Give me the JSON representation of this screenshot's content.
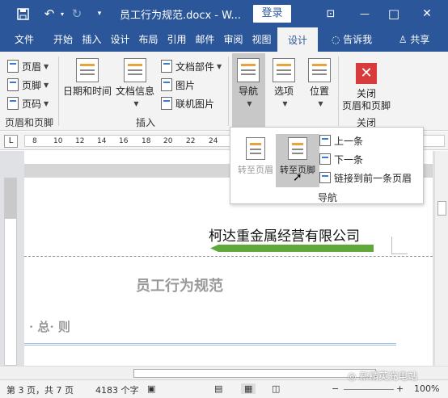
{
  "window": {
    "title": "员工行为规范.docx - W...",
    "login_label": "登录",
    "accent": "#2b579a"
  },
  "quick_access": {
    "save_icon": "save-icon",
    "undo_icon": "undo-icon",
    "redo_icon": "redo-icon",
    "customize_icon": "customize-icon"
  },
  "window_controls": {
    "ribbon_display": "⊡",
    "minimize": "—",
    "maximize": "□",
    "close": "✕"
  },
  "tabs": [
    {
      "label": "文件"
    },
    {
      "label": "开始"
    },
    {
      "label": "插入"
    },
    {
      "label": "设计"
    },
    {
      "label": "布局"
    },
    {
      "label": "引用"
    },
    {
      "label": "邮件"
    },
    {
      "label": "审阅"
    },
    {
      "label": "视图"
    },
    {
      "label": "设计",
      "active": true
    },
    {
      "label": "告诉我"
    },
    {
      "label": "共享"
    }
  ],
  "ribbon": {
    "header_footer_group": {
      "items": [
        "页眉",
        "页脚",
        "页码"
      ],
      "label": "页眉和页脚"
    },
    "insert_group": {
      "date_time": "日期和时间",
      "doc_info": "文档信息",
      "doc_parts": "文档部件",
      "picture": "图片",
      "online_picture": "联机图片",
      "label": "插入"
    },
    "nav_group": {
      "navigation": "导航",
      "options": "选项",
      "position": "位置"
    },
    "close_group": {
      "close_line1": "关闭",
      "close_line2": "页眉和页脚",
      "label": "关闭"
    }
  },
  "ruler": {
    "corner": "L",
    "numbers": [
      "8",
      "10",
      "12",
      "14",
      "16",
      "18",
      "20",
      "22",
      "24"
    ]
  },
  "nav_popup": {
    "goto_header": "转至页眉",
    "goto_footer": "转至页脚",
    "previous": "上一条",
    "next": "下一条",
    "link_previous": "链接到前一条页眉",
    "label": "导航"
  },
  "document": {
    "company": "柯达重金属经营有限公司",
    "title": "员工行为规范",
    "heading": "· 总· 则"
  },
  "status": {
    "page": "第 3 页，共 7 页",
    "words": "4183 个字",
    "zoom": "100%"
  },
  "watermark": "新精英充电站"
}
